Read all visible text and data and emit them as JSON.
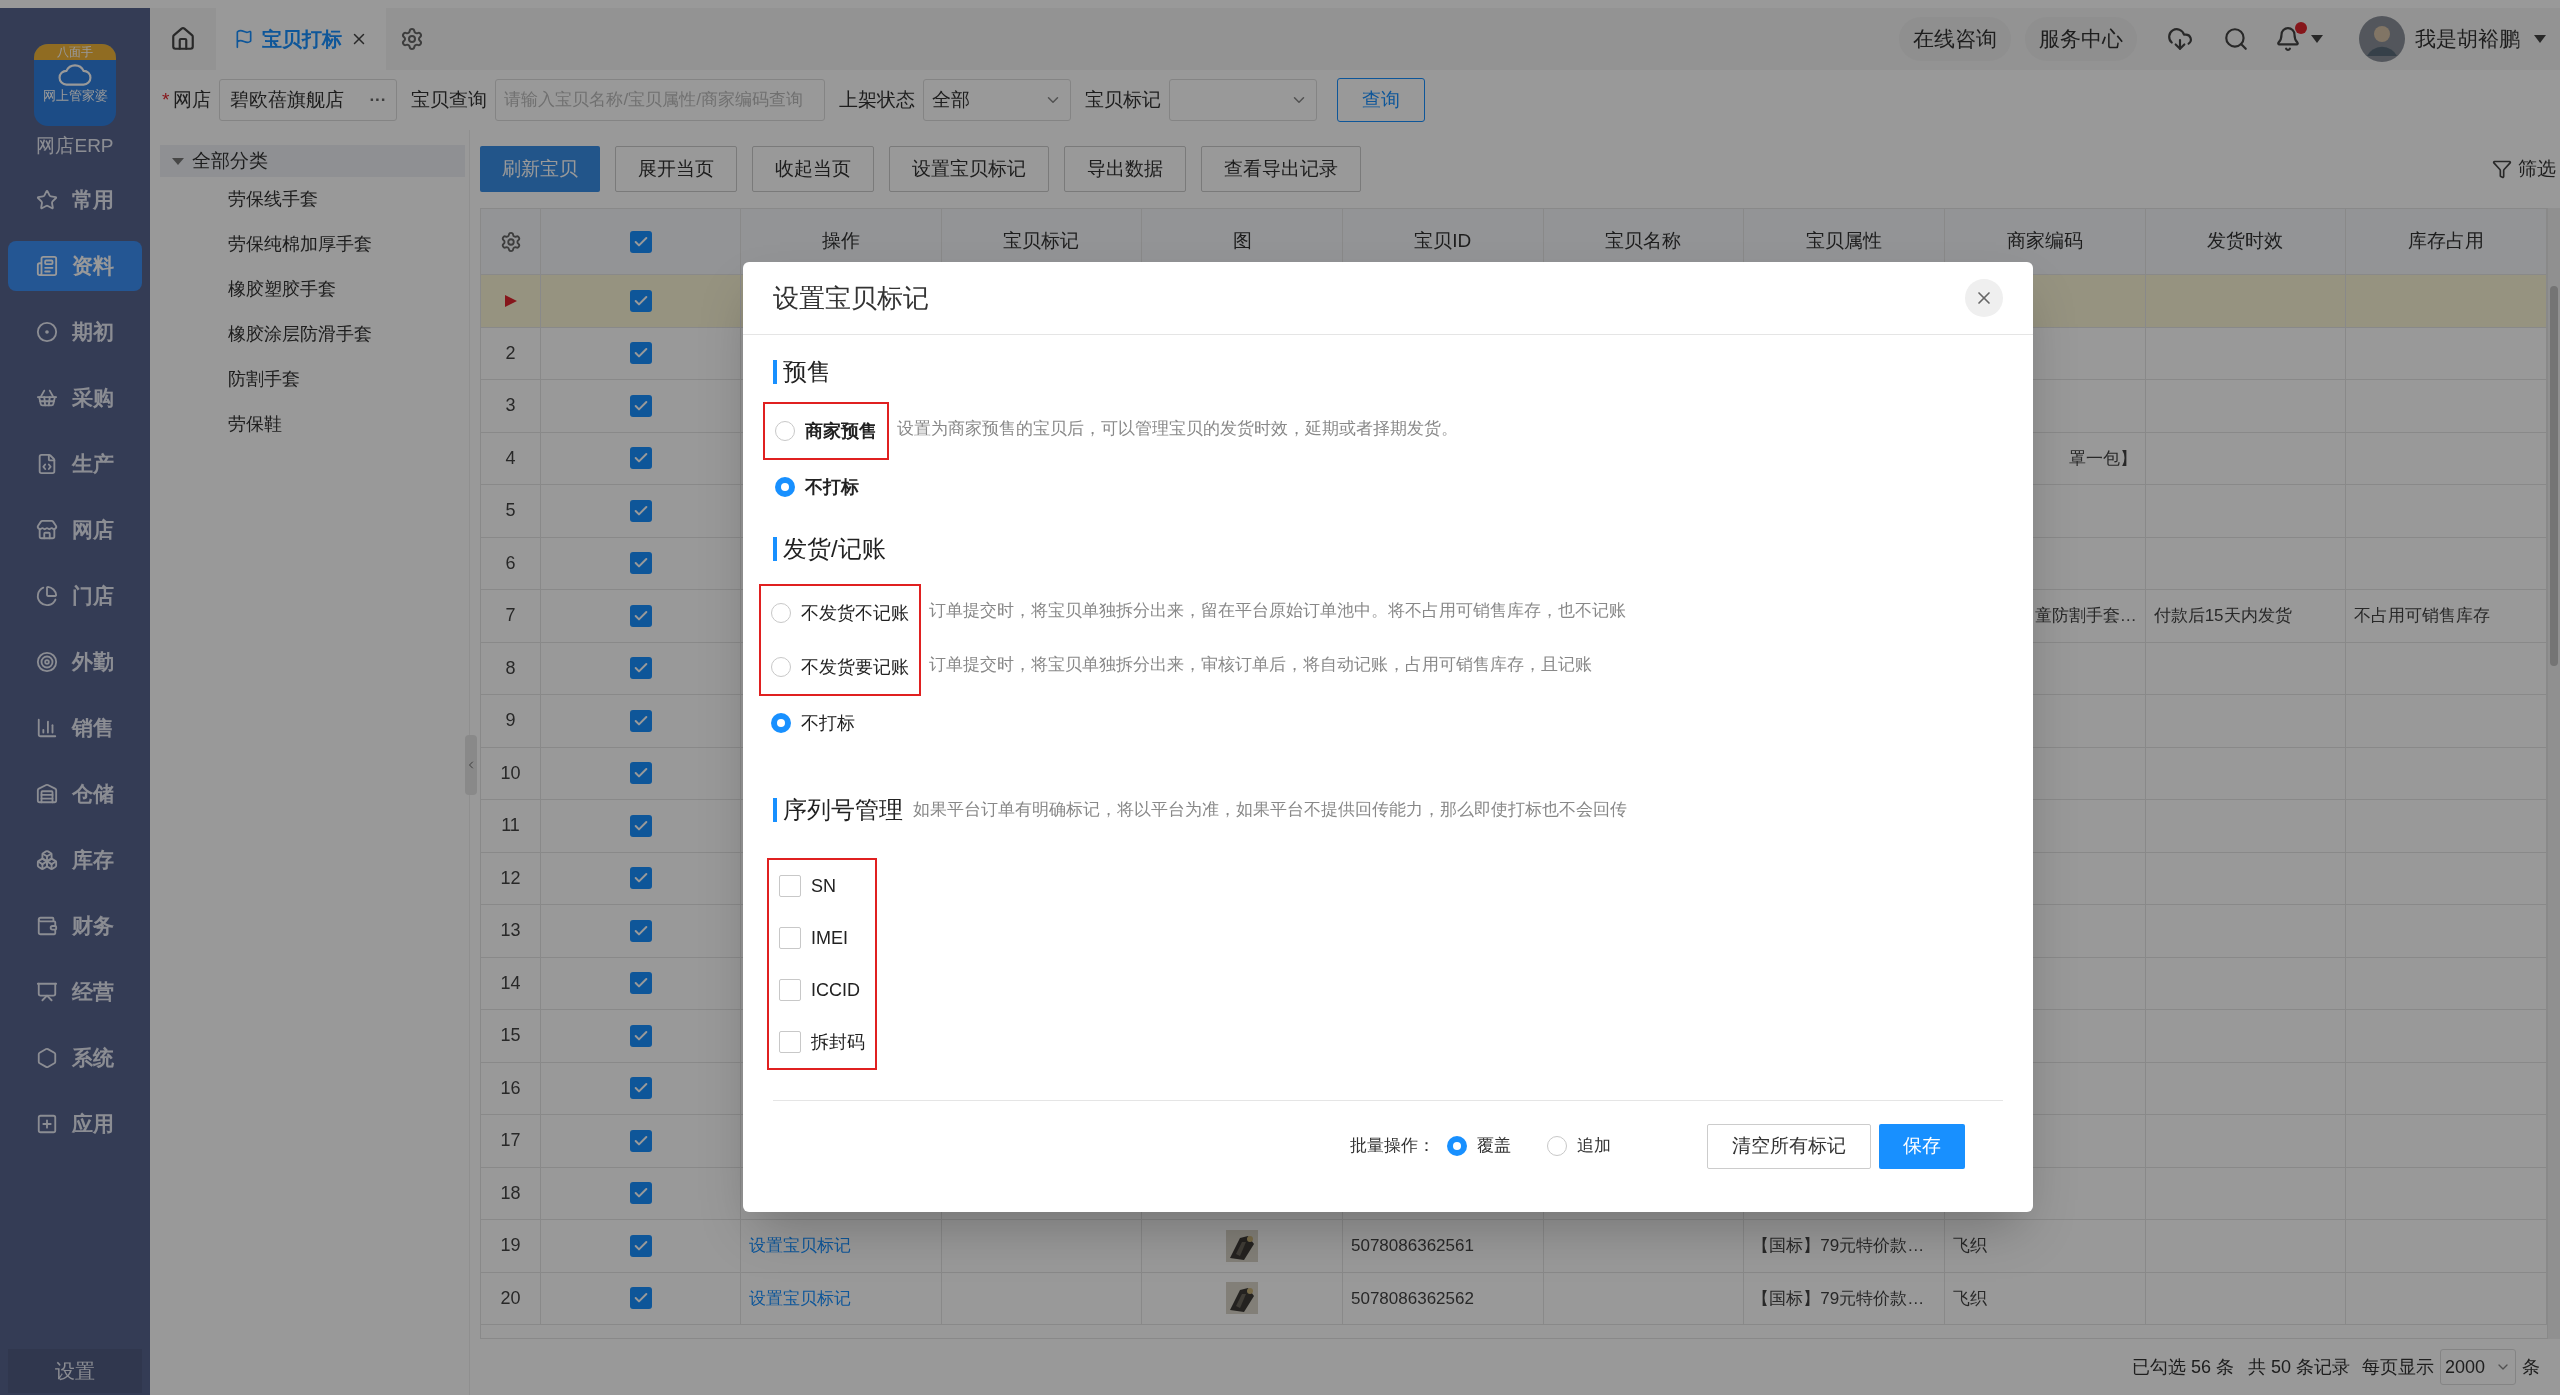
{
  "logo": {
    "badge": "八面手",
    "caption": "网上管家婆",
    "name": "网店ERP"
  },
  "nav": [
    {
      "label": "常用",
      "selected": false
    },
    {
      "label": "资料",
      "selected": true
    },
    {
      "label": "期初",
      "selected": false
    },
    {
      "label": "采购",
      "selected": false
    },
    {
      "label": "生产",
      "selected": false
    },
    {
      "label": "网店",
      "selected": false
    },
    {
      "label": "门店",
      "selected": false
    },
    {
      "label": "外勤",
      "selected": false
    },
    {
      "label": "销售",
      "selected": false
    },
    {
      "label": "仓储",
      "selected": false
    },
    {
      "label": "库存",
      "selected": false
    },
    {
      "label": "财务",
      "selected": false
    },
    {
      "label": "经营",
      "selected": false
    },
    {
      "label": "系统",
      "selected": false
    },
    {
      "label": "应用",
      "selected": false
    }
  ],
  "settings": "设置",
  "tabs": [
    {
      "label": "宝贝打标",
      "selected": true
    }
  ],
  "topbar": {
    "links": [
      "在线咨询",
      "服务中心"
    ],
    "notifications_unread": true,
    "user": "我是胡裕鹏"
  },
  "filters": {
    "shop": {
      "label": "网店",
      "required_mark": "*",
      "value": "碧欧蓓旗舰店",
      "more": "···"
    },
    "query": {
      "label": "宝贝查询",
      "placeholder": "请输入宝贝名称/宝贝属性/商家编码查询"
    },
    "status": {
      "label": "上架状态",
      "value": "全部"
    },
    "mark": {
      "label": "宝贝标记"
    },
    "search_button": "查询"
  },
  "category_tree": {
    "label": "全部分类",
    "expanded": true,
    "children": [
      {
        "label": "劳保线手套"
      },
      {
        "label": "劳保纯棉加厚手套"
      },
      {
        "label": "橡胶塑胶手套"
      },
      {
        "label": "橡胶涂层防滑手套"
      },
      {
        "label": "防割手套"
      },
      {
        "label": "劳保鞋"
      }
    ]
  },
  "toolbar": {
    "buttons": [
      {
        "label": "刷新宝贝",
        "primary": true
      },
      {
        "label": "展开当页",
        "primary": false
      },
      {
        "label": "收起当页",
        "primary": false
      },
      {
        "label": "设置宝贝标记",
        "primary": false
      },
      {
        "label": "导出数据",
        "primary": false
      },
      {
        "label": "查看导出记录",
        "primary": false
      }
    ],
    "filter": "筛选"
  },
  "table": {
    "all_checked": true,
    "columns": [
      "操作",
      "宝贝标记",
      "图",
      "宝贝ID",
      "宝贝名称",
      "宝贝属性",
      "商家编码",
      "发货时效",
      "库存占用"
    ],
    "rows": [
      {
        "current": true,
        "checked": true
      },
      {
        "current": false,
        "number": "2",
        "checked": true
      },
      {
        "current": false,
        "number": "3",
        "checked": true
      },
      {
        "current": false,
        "number": "4",
        "checked": true,
        "merchant_code": "罩一包】"
      },
      {
        "current": false,
        "number": "5",
        "checked": true
      },
      {
        "current": false,
        "number": "6",
        "checked": true
      },
      {
        "current": false,
        "number": "7",
        "checked": true,
        "merchant_code": "童防割手套…",
        "shipping_time": "付款后15天内发货",
        "stock_usage": "不占用可销售库存"
      },
      {
        "current": false,
        "number": "8",
        "checked": true
      },
      {
        "current": false,
        "number": "9",
        "checked": true
      },
      {
        "current": false,
        "number": "10",
        "checked": true
      },
      {
        "current": false,
        "number": "11",
        "checked": true
      },
      {
        "current": false,
        "number": "12",
        "checked": true
      },
      {
        "current": false,
        "number": "13",
        "checked": true
      },
      {
        "current": false,
        "number": "14",
        "checked": true
      },
      {
        "current": false,
        "number": "15",
        "checked": true
      },
      {
        "current": false,
        "number": "16",
        "checked": true
      },
      {
        "current": false,
        "number": "17",
        "checked": true
      },
      {
        "current": false,
        "number": "18",
        "checked": true
      },
      {
        "current": false,
        "number": "19",
        "checked": true,
        "operation": "设置宝贝标记",
        "item_id": "5078086362561",
        "attributes": "【国标】79元特价款…",
        "merchant_code": "飞织"
      },
      {
        "current": false,
        "number": "20",
        "checked": true,
        "operation": "设置宝贝标记",
        "item_id": "5078086362562",
        "attributes": "【国标】79元特价款…",
        "merchant_code": "飞织"
      }
    ]
  },
  "footer": {
    "selected": "已勾选 56 条",
    "total": "共 50 条记录",
    "page_size_label": "每页显示",
    "page_size": "2000",
    "unit": "条"
  },
  "modal": {
    "title": "设置宝贝标记",
    "presale": {
      "title": "预售",
      "options": [
        {
          "label": "商家预售",
          "description": "设置为商家预售的宝贝后，可以管理宝贝的发货时效，延期或者择期发货。",
          "selected": false,
          "highlighted": true
        },
        {
          "label": "不打标",
          "selected": true,
          "highlighted": false
        }
      ]
    },
    "shipping": {
      "title": "发货/记账",
      "options": [
        {
          "label": "不发货不记账",
          "description": "订单提交时，将宝贝单独拆分出来，留在平台原始订单池中。将不占用可销售库存，也不记账",
          "selected": false,
          "highlighted": true
        },
        {
          "label": "不发货要记账",
          "description": "订单提交时，将宝贝单独拆分出来，审核订单后，将自动记账，占用可销售库存，且记账",
          "selected": false,
          "highlighted": true
        },
        {
          "label": "不打标",
          "selected": true,
          "highlighted": false
        }
      ]
    },
    "serial": {
      "title": "序列号管理",
      "note": "如果平台订单有明确标记，将以平台为准，如果平台不提供回传能力，那么即使打标也不会回传",
      "options": [
        {
          "label": "SN",
          "checked": false,
          "highlighted": true
        },
        {
          "label": "IMEI",
          "checked": false,
          "highlighted": true
        },
        {
          "label": "ICCID",
          "checked": false,
          "highlighted": true
        },
        {
          "label": "拆封码",
          "checked": false,
          "highlighted": true
        }
      ]
    },
    "batch": {
      "label": "批量操作：",
      "options": [
        {
          "label": "覆盖",
          "selected": true
        },
        {
          "label": "追加",
          "selected": false
        }
      ]
    },
    "buttons": [
      {
        "label": "清空所有标记",
        "primary": false
      },
      {
        "label": "保存",
        "primary": true
      }
    ]
  }
}
